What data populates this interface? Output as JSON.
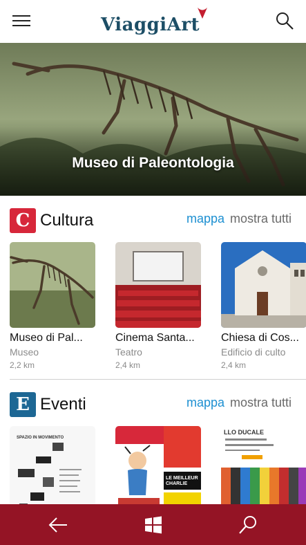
{
  "app": {
    "logo_text": "ViaggiArt"
  },
  "hero": {
    "title": "Museo di Paleontologia"
  },
  "sections": [
    {
      "badge_letter": "C",
      "badge_color": "#d7273a",
      "title": "Cultura",
      "map_label": "mappa",
      "all_label": "mostra tutti",
      "cards": [
        {
          "name": "Museo di Pal...",
          "category": "Museo",
          "distance": "2,2 km"
        },
        {
          "name": "Cinema Santa...",
          "category": "Teatro",
          "distance": "2,4 km"
        },
        {
          "name": "Chiesa di Cos...",
          "category": "Edificio di culto",
          "distance": "2,4 km"
        }
      ]
    },
    {
      "badge_letter": "E",
      "badge_color": "#1d6794",
      "title": "Eventi",
      "map_label": "mappa",
      "all_label": "mostra tutti",
      "cards": [
        {
          "poster_text": "SPAZIO IN MOVIMENTO"
        },
        {
          "poster_text": "LE MEILLEUR CHARLIE"
        },
        {
          "poster_text": "LLO DUCALE"
        }
      ]
    }
  ],
  "colors": {
    "accent": "#1c8fd1",
    "bottom_bar": "#941425",
    "logo": "#1d4e66"
  },
  "icons": {
    "top_left": "hamburger-icon",
    "top_right": "search-icon",
    "bottom": [
      "back-arrow-icon",
      "windows-start-icon",
      "search-icon"
    ]
  }
}
